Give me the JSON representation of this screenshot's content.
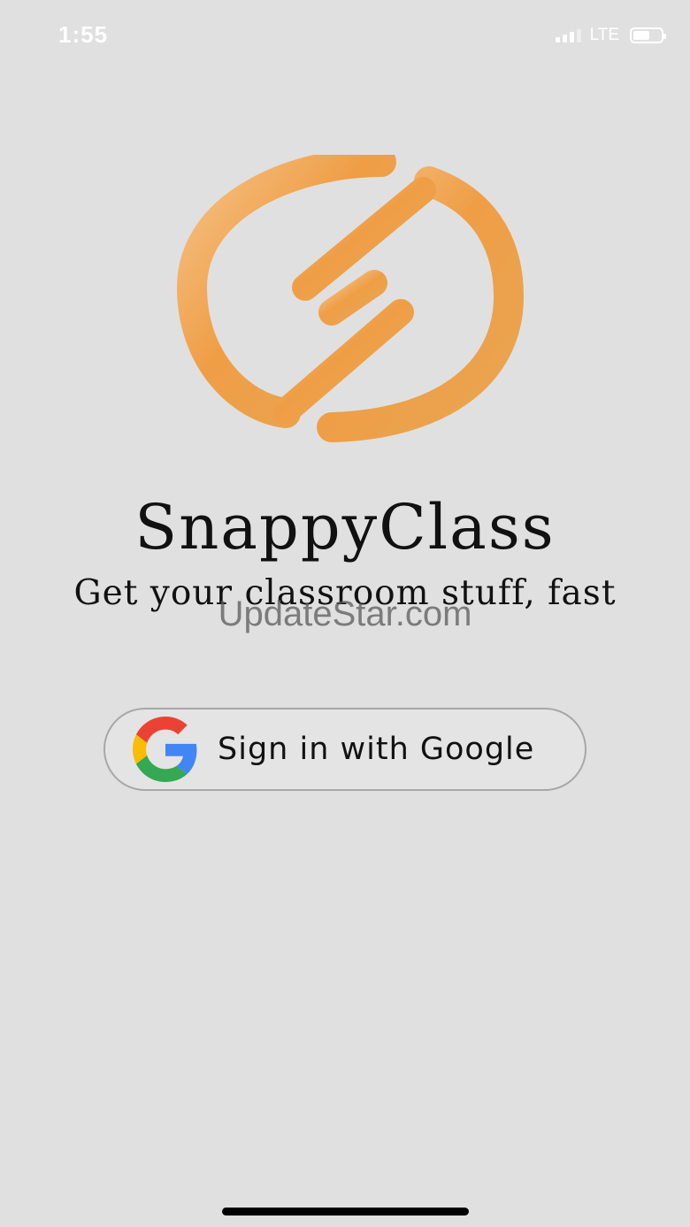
{
  "status_bar": {
    "time": "1:55",
    "network": "LTE",
    "battery_level": 0.6
  },
  "app": {
    "name": "SnappyClass",
    "tagline": "Get your classroom stuff, fast",
    "logo_icon": "snappyclass-logo-icon",
    "accent_color": "#F0A04B"
  },
  "watermark": "UpdateStar.com",
  "google_signin": {
    "label": "Sign in with Google",
    "icon": "google-g-icon"
  }
}
